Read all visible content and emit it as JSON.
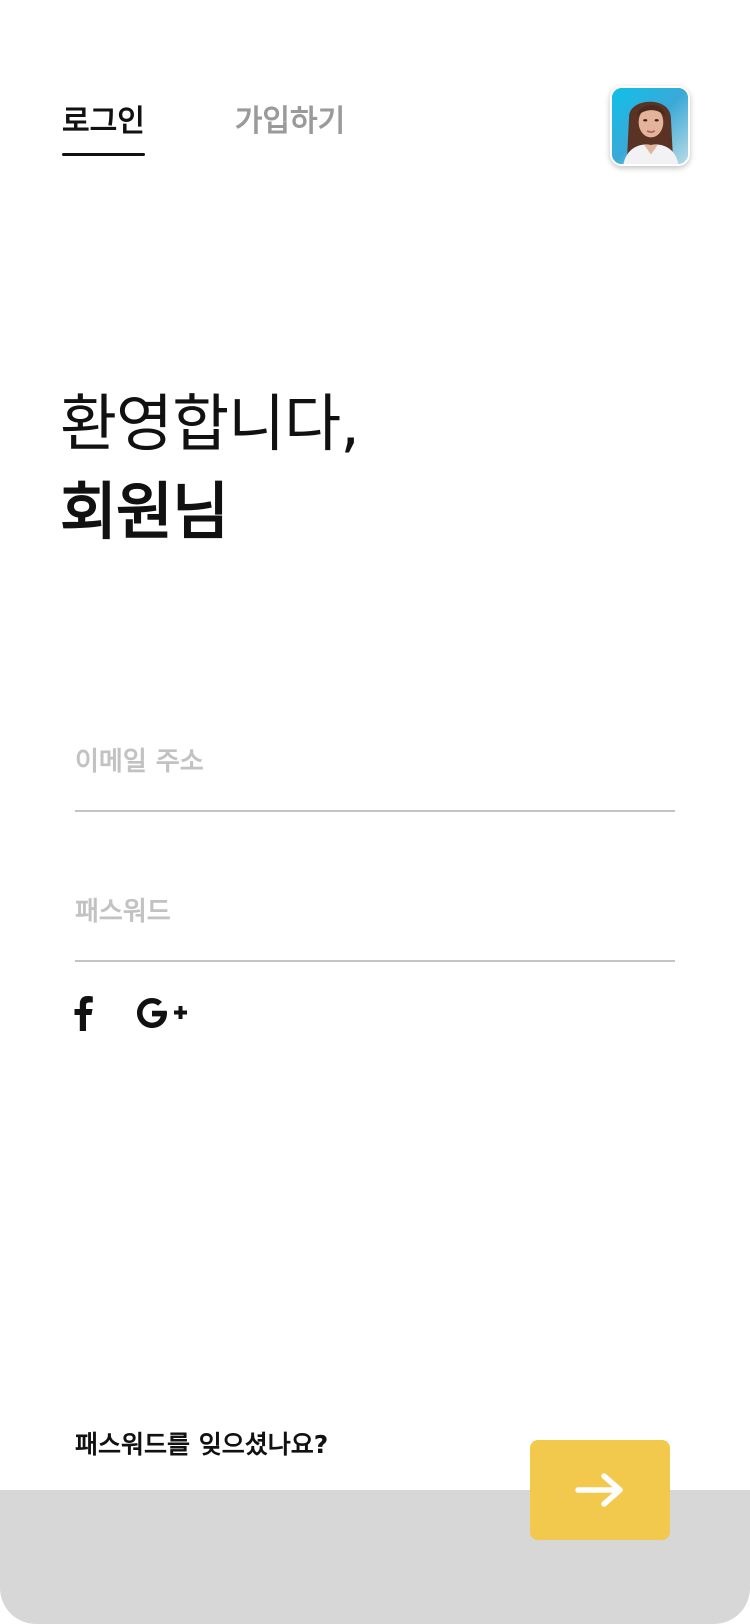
{
  "tabs": {
    "login_label": "로그인",
    "signup_label": "가입하기"
  },
  "greeting": {
    "line1": "환영합니다,",
    "line2": "회원님"
  },
  "form": {
    "email_placeholder": "이메일 주소",
    "password_placeholder": "패스워드"
  },
  "social": {
    "facebook_icon": "facebook-icon",
    "google_icon": "google-plus-icon"
  },
  "forgot_password": "패스워드를 잊으셨나요?",
  "submit_icon": "arrow-right-icon",
  "colors": {
    "accent": "#f2c94c",
    "text": "#111111",
    "muted": "#9a9a9a",
    "placeholder": "#c2c2c2",
    "divider": "#c4c4c4",
    "bottom_band": "#d7d7d7"
  }
}
